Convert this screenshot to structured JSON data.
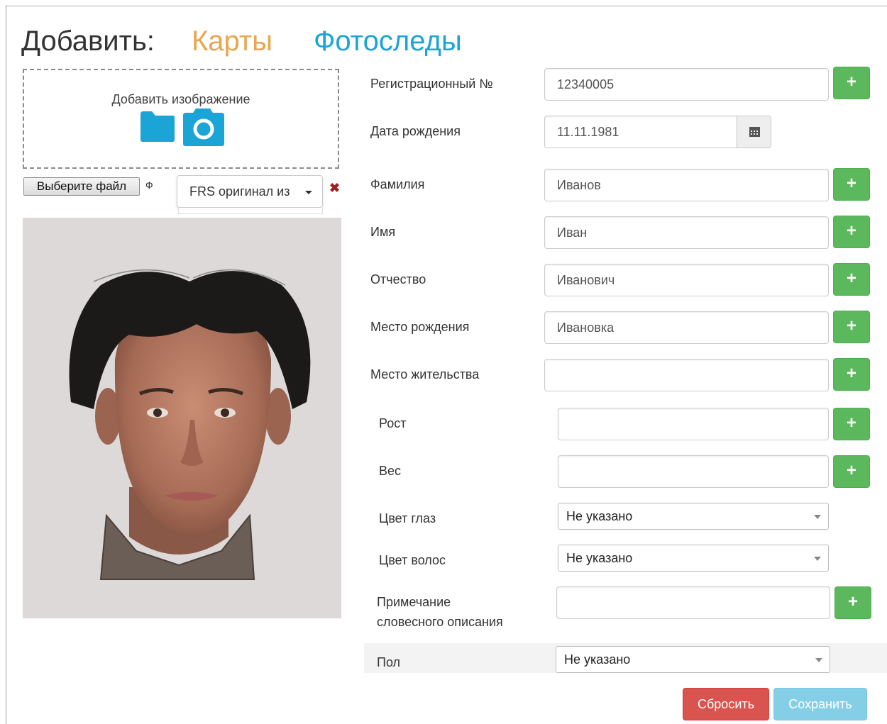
{
  "header": {
    "title": "Добавить:",
    "cards_link": "Карты",
    "photo_link": "Фотоследы"
  },
  "upload": {
    "dropzone_label": "Добавить изображение",
    "choose_file_label": "Выберите файл",
    "file_status": "Ф",
    "source_dropdown": "FRS оригинал из",
    "icons": {
      "folder": "folder-icon",
      "camera": "camera-icon",
      "remove": "remove-icon"
    }
  },
  "form": {
    "fields": [
      {
        "label": "Регистрационный №",
        "value": "12340005"
      },
      {
        "label": "Дата рождения",
        "value": "11.11.1981"
      },
      {
        "label": "Фамилия",
        "value": "Иванов"
      },
      {
        "label": "Имя",
        "value": "Иван"
      },
      {
        "label": "Отчество",
        "value": "Иванович"
      },
      {
        "label": "Место рождения",
        "value": "Ивановка"
      },
      {
        "label": "Место жительства",
        "value": ""
      },
      {
        "label": "Рост",
        "value": ""
      },
      {
        "label": "Вес",
        "value": ""
      },
      {
        "label": "Цвет глаз",
        "value": "Не указано"
      },
      {
        "label": "Цвет волос",
        "value": "Не указано"
      },
      {
        "label": "Примечание",
        "label2": "словесного описания",
        "value": ""
      },
      {
        "label": "Пол",
        "value": "Не указано"
      }
    ],
    "plus_label": "+"
  },
  "actions": {
    "reset": "Сбросить",
    "save": "Сохранить"
  },
  "colors": {
    "cards_link": "#e8a64d",
    "photo_link": "#1ba4d6",
    "plus_button": "#5cb85c",
    "reset_button": "#d9534f",
    "save_button": "#5bc0de",
    "icon_blue": "#1ba4d6"
  }
}
